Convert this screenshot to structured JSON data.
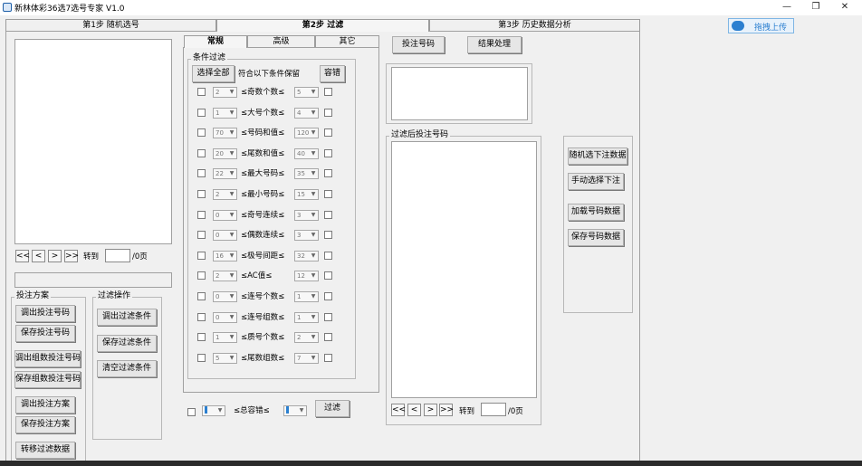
{
  "window": {
    "title": "新林体彩36选7选号专家 V1.0",
    "minimize": "—",
    "restore": "❐",
    "close": "✕"
  },
  "cloud_upload": {
    "label": "拖拽上传",
    "icon": "cloud-icon"
  },
  "main_tabs": [
    {
      "label": "第1步 随机选号"
    },
    {
      "label": "第2步 过滤"
    },
    {
      "label": "第3步 历史数据分析"
    }
  ],
  "left": {
    "nav_first": "<<",
    "nav_prev": "<",
    "nav_next": ">",
    "nav_last": ">>",
    "goto_label": "转到",
    "page_suffix": "/0页",
    "scheme_group": "投注方案",
    "filter_op_group": "过滤操作",
    "buttons": {
      "load_bet_numbers": "调出投注号码",
      "save_bet_numbers": "保存投注号码",
      "load_group_numbers": "调出组数投注号码",
      "save_group_numbers": "保存组数投注号码",
      "load_bet_scheme": "调出投注方案",
      "save_bet_scheme": "保存投注方案",
      "transfer_filter_data": "转移过滤数据",
      "load_filter": "调出过滤条件",
      "save_filter": "保存过滤条件",
      "clear_filter": "清空过滤条件"
    }
  },
  "filter_tabs": [
    {
      "label": "常规"
    },
    {
      "label": "高级"
    },
    {
      "label": "其它"
    }
  ],
  "conditions": {
    "group_label": "条件过滤",
    "select_all": "选择全部",
    "keep_label": "符合以下条件保留",
    "tolerance": "容错",
    "rows": [
      {
        "label": "≤奇数个数≤",
        "min": "2",
        "max": "5"
      },
      {
        "label": "≤大号个数≤",
        "min": "1",
        "max": "4"
      },
      {
        "label": "≤号码和值≤",
        "min": "70",
        "max": "120"
      },
      {
        "label": "≤尾数和值≤",
        "min": "20",
        "max": "40"
      },
      {
        "label": "≤最大号码≤",
        "min": "22",
        "max": "35"
      },
      {
        "label": "≤最小号码≤",
        "min": "2",
        "max": "15"
      },
      {
        "label": "≤奇号连续≤",
        "min": "0",
        "max": "3"
      },
      {
        "label": "≤偶数连续≤",
        "min": "0",
        "max": "3"
      },
      {
        "label": "≤极号间距≤",
        "min": "16",
        "max": "32"
      },
      {
        "label": "≤AC值≤",
        "min": "2",
        "max": "12"
      },
      {
        "label": "≤连号个数≤",
        "min": "0",
        "max": "1"
      },
      {
        "label": "≤连号组数≤",
        "min": "0",
        "max": "1"
      },
      {
        "label": "≤质号个数≤",
        "min": "1",
        "max": "2"
      },
      {
        "label": "≤尾数组数≤",
        "min": "5",
        "max": "7"
      }
    ],
    "total_tolerance": "≤总容错≤",
    "filter_button": "过滤"
  },
  "right": {
    "bet_numbers_button": "投注号码",
    "result_button": "结果处理",
    "filtered_group": "过滤后投注号码",
    "goto_label": "转到",
    "page_suffix": "/0页",
    "nav_first": "<<",
    "nav_prev": "<",
    "nav_next": ">",
    "nav_last": ">>",
    "side_buttons": {
      "random_select": "随机选下注数据",
      "manual_select": "手动选择下注",
      "load_numbers": "加载号码数据",
      "save_numbers": "保存号码数据"
    }
  }
}
